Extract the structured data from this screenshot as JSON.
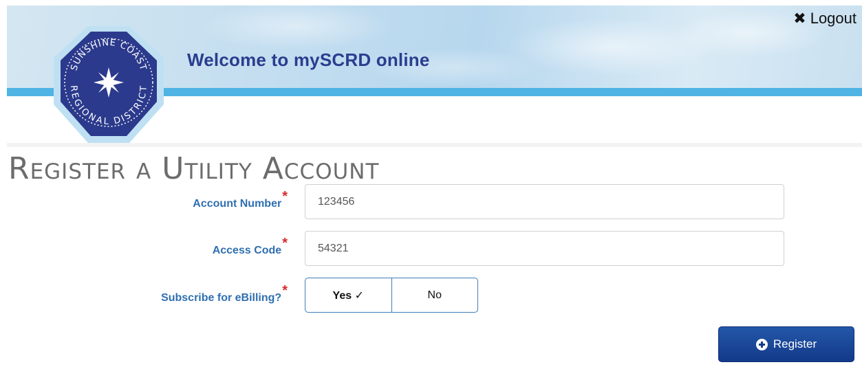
{
  "header": {
    "welcome_text": "Welcome to mySCRD online",
    "logout_label": "Logout",
    "logo_top_text": "SUNSHINE COAST",
    "logo_bottom_text": "REGIONAL DISTRICT"
  },
  "page_title": "Register a Utility Account",
  "form": {
    "account_number": {
      "label": "Account Number",
      "required_mark": "*",
      "value": "123456"
    },
    "access_code": {
      "label": "Access Code",
      "required_mark": "*",
      "value": "54321"
    },
    "ebilling": {
      "label": "Subscribe for eBilling?",
      "required_mark": "*",
      "yes_label": "Yes ✓",
      "no_label": "No",
      "selected": "Yes"
    }
  },
  "register_button": {
    "label": "Register",
    "icon": "plus-circle-icon"
  },
  "colors": {
    "brand_navy": "#2a3d8f",
    "stripe_blue": "#4fb4e4",
    "label_blue": "#2f6fb1",
    "required_red": "#d62b2b",
    "button_blue": "#13398a"
  }
}
